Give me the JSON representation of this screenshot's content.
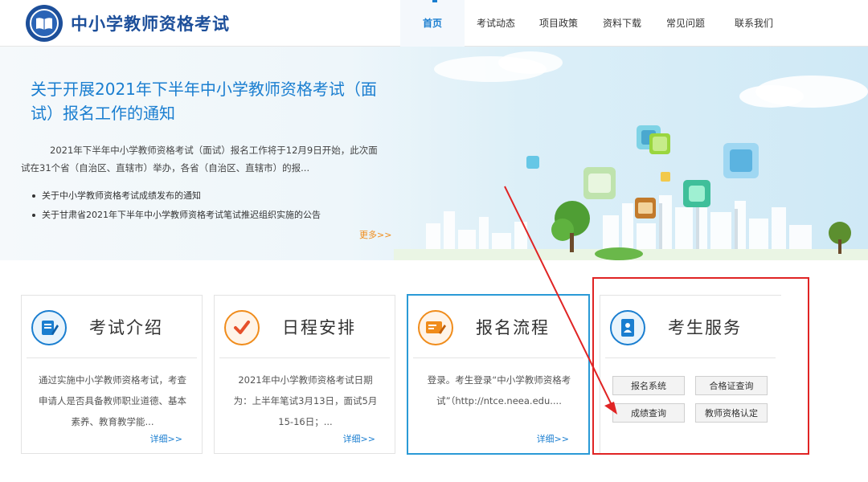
{
  "header": {
    "logo_title": "中小学教师资格考试",
    "nav": [
      {
        "label": "首页",
        "active": true
      },
      {
        "label": "考试动态",
        "active": false
      },
      {
        "label": "项目政策",
        "active": false
      },
      {
        "label": "资料下载",
        "active": false
      },
      {
        "label": "常见问题",
        "active": false
      },
      {
        "label": "联系我们",
        "active": false
      }
    ]
  },
  "banner": {
    "title": "关于开展2021年下半年中小学教师资格考试（面试）报名工作的通知",
    "description": "2021年下半年中小学教师资格考试（面试）报名工作将于12月9日开始，此次面试在31个省（自治区、直辖市）举办，各省（自治区、直辖市）的报...",
    "links": [
      "关于中小学教师资格考试成绩发布的通知",
      "关于甘肃省2021年下半年中小学教师资格考试笔试推迟组织实施的公告"
    ],
    "more": "更多>>"
  },
  "cards": [
    {
      "title": "考试介绍",
      "text": "通过实施中小学教师资格考试，考查申请人是否具备教师职业道德、基本素养、教育教学能...",
      "detail": "详细>>",
      "icon": "document-pen-icon"
    },
    {
      "title": "日程安排",
      "text": "2021年中小学教师资格考试日期为：上半年笔试3月13日，面试5月15-16日；...",
      "detail": "详细>>",
      "icon": "checkmark-icon"
    },
    {
      "title": "报名流程",
      "text": "登录。考生登录“中小学教师资格考试”（http://ntce.neea.edu....",
      "detail": "详细>>",
      "icon": "card-pen-icon"
    }
  ],
  "service": {
    "title": "考生服务",
    "icon": "student-id-icon",
    "buttons": [
      "报名系统",
      "合格证查询",
      "成绩查询",
      "教师资格认定"
    ]
  },
  "colors": {
    "brand_blue": "#1d4f9a",
    "link_blue": "#1a7ed0",
    "accent_orange": "#f08c1b",
    "annotation_red": "#e02424"
  }
}
